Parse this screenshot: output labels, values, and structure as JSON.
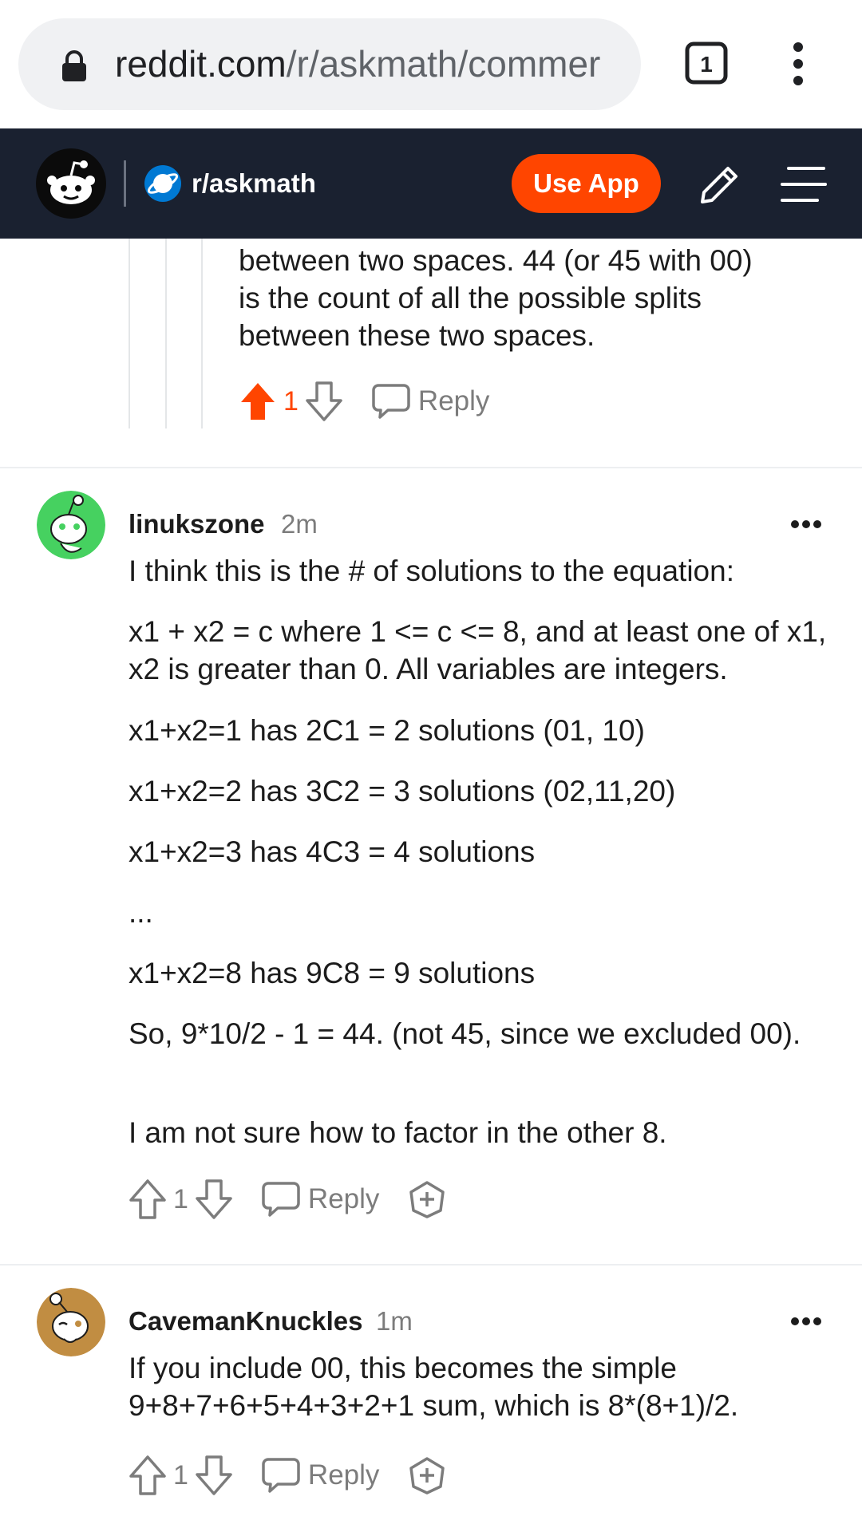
{
  "browser": {
    "url_domain": "reddit.com",
    "url_path": "/r/askmath/commer",
    "tab_count": "1",
    "icons": {
      "lock": "lock-icon",
      "tabs": "tab-switcher-icon",
      "menu": "kebab-menu-icon"
    }
  },
  "header": {
    "subreddit": "r/askmath",
    "use_app_label": "Use App",
    "accent": "#ff4500",
    "background": "#1a2130"
  },
  "prev_comment": {
    "lines": [
      "between two spaces. 44 (or 45 with 00)",
      "is the count of all the possible splits",
      "between these two spaces."
    ],
    "votes": "1",
    "reply_label": "Reply"
  },
  "comments": [
    {
      "username": "linukszone",
      "time": "2m",
      "paragraphs": [
        "I think this is the # of solutions to the equation:",
        "x1 + x2 = c where 1 <= c <= 8, and at least one of x1, x2 is greater than 0. All variables are integers.",
        "x1+x2=1 has 2C1 = 2 solutions (01, 10)",
        "x1+x2=2 has 3C2 = 3 solutions (02,11,20)",
        "x1+x2=3 has 4C3 = 4 solutions",
        "...",
        "x1+x2=8 has 9C8 = 9 solutions",
        "So, 9*10/2 - 1 = 44. (not 45, since we excluded 00).",
        "I am not sure how to factor in the other 8."
      ],
      "votes": "1",
      "reply_label": "Reply"
    },
    {
      "username": "CavemanKnuckles",
      "time": "1m",
      "paragraphs": [
        "If you include 00, this becomes the simple 9+8+7+6+5+4+3+2+1 sum, which is 8*(8+1)/2."
      ],
      "votes": "1",
      "reply_label": "Reply"
    }
  ]
}
